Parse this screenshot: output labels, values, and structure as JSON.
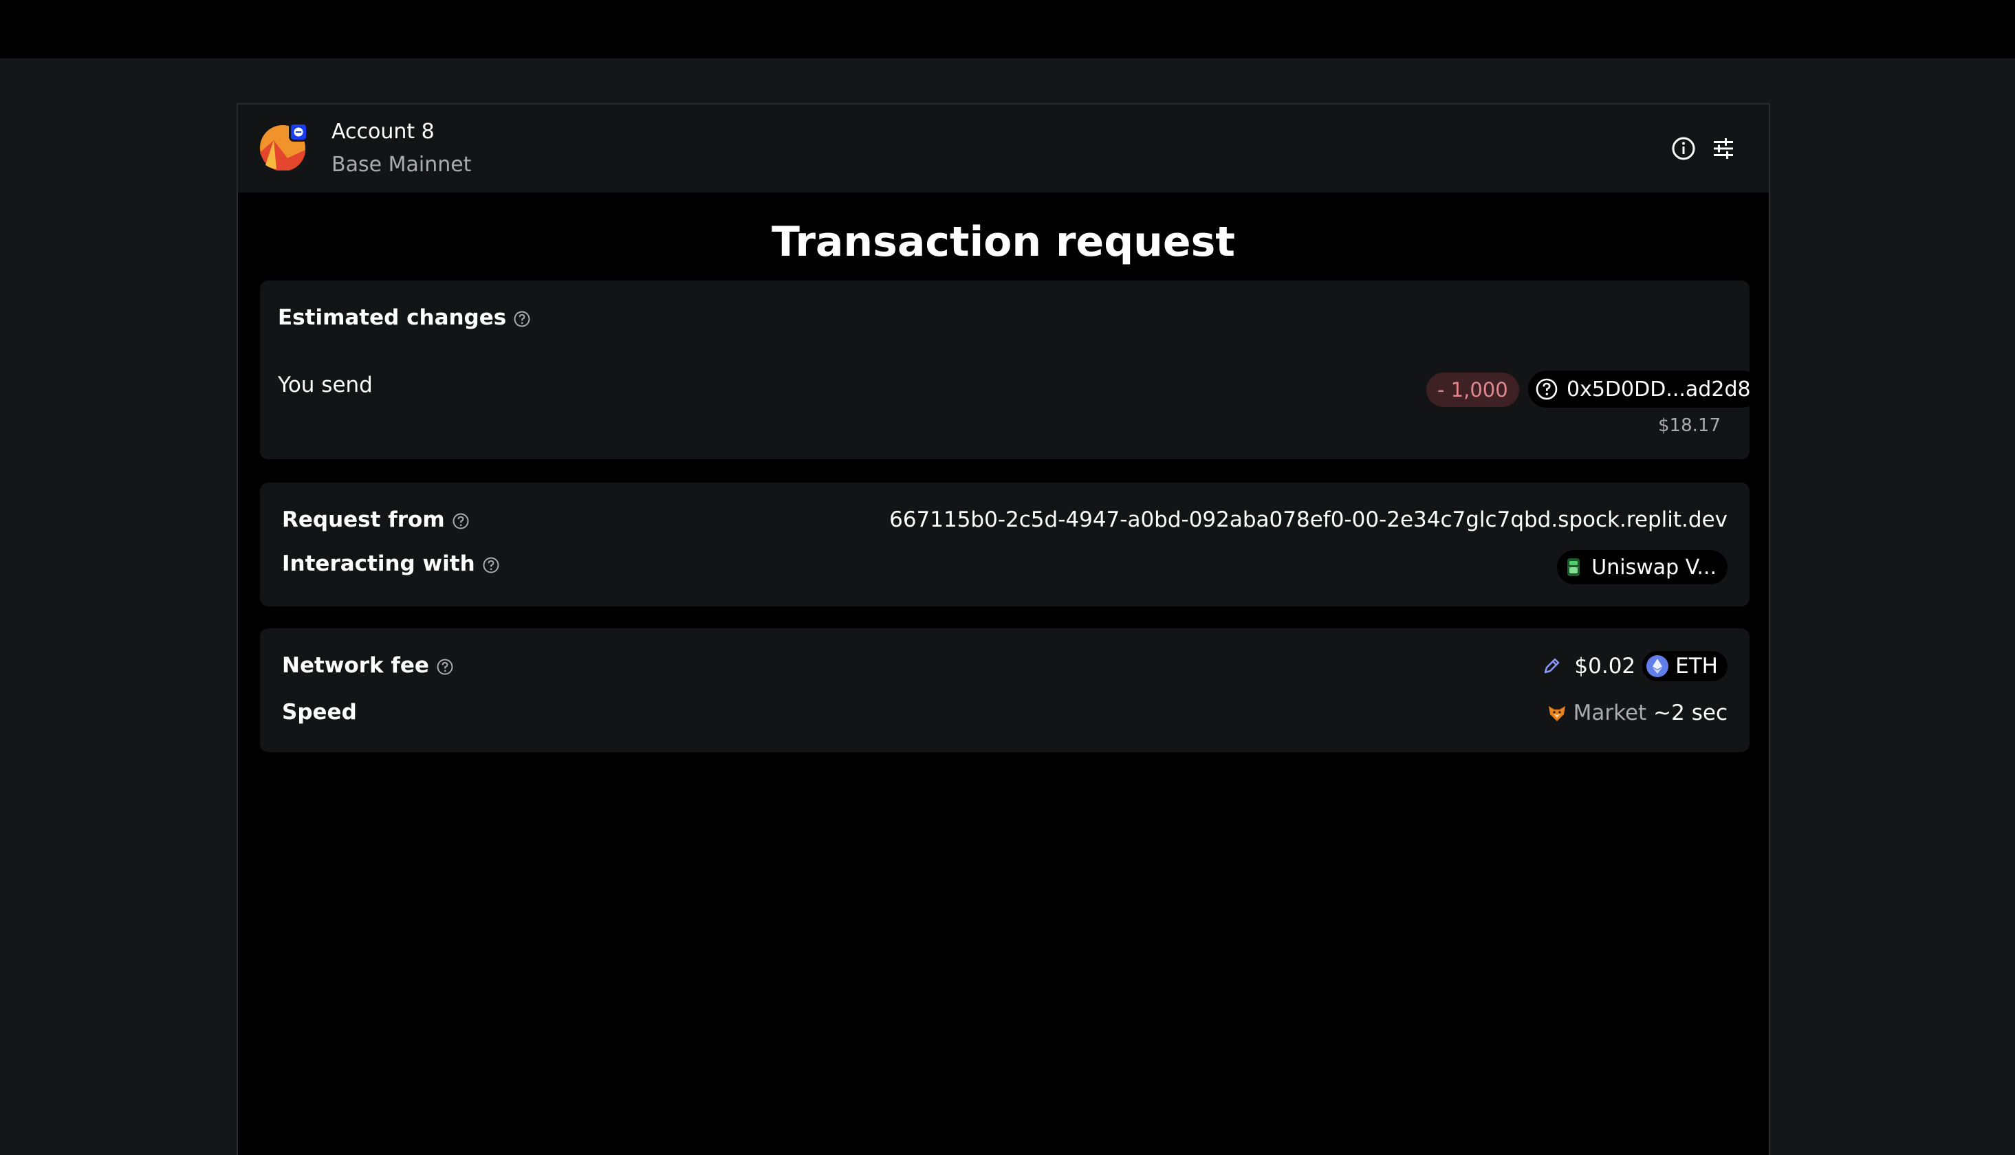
{
  "header": {
    "account_name": "Account 8",
    "network_name": "Base Mainnet",
    "icons": [
      "info-icon",
      "settings-sliders-icon"
    ]
  },
  "page": {
    "title": "Transaction request"
  },
  "estimated_changes": {
    "label": "Estimated changes",
    "you_send_label": "You send",
    "amount": "- 1,000",
    "token": "0x5D0DD...ad2d8",
    "usd_value": "$18.17"
  },
  "request": {
    "from_label": "Request from",
    "from_value": "667115b0-2c5d-4947-a0bd-092aba078ef0-00-2e34c7glc7qbd.spock.replit.dev",
    "interacting_label": "Interacting with",
    "interacting_value": "Uniswap V..."
  },
  "fee": {
    "network_fee_label": "Network fee",
    "amount": "$0.02",
    "currency": "ETH",
    "speed_label": "Speed",
    "speed_name": "Market",
    "speed_time": "~2 sec"
  },
  "colors": {
    "background": "#141618",
    "panel": "#000000",
    "card": "#131416",
    "negative_text": "#e0888d",
    "negative_bg": "#3d2125",
    "badge": "#1c3cf0",
    "eth": "#627eea"
  }
}
